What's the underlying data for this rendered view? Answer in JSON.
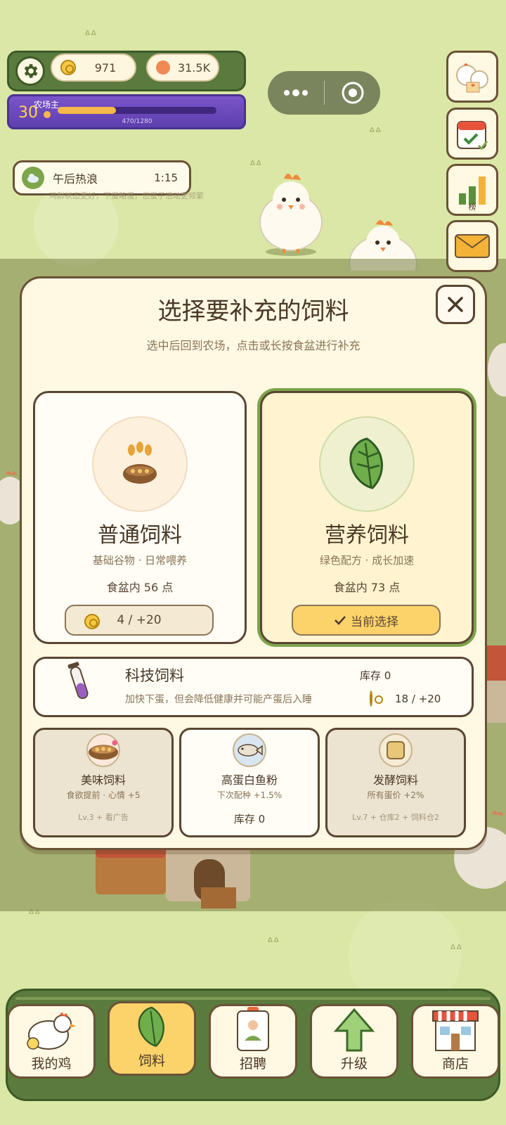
{
  "hud": {
    "coins": "971",
    "eggs": "31.5K",
    "level": "30",
    "level_title": "农场主",
    "xp_text": "470/1280",
    "xp_progress": 0.367
  },
  "weather": {
    "name": "午后热浪",
    "time": "1:15",
    "note": "鸡群状态更好，下蛋略慢，但蛋子活动更频繁"
  },
  "side_buttons": {
    "rank_label": "榜"
  },
  "modal": {
    "title": "选择要补充的饲料",
    "subtitle": "选中后回到农场，点击或长按食盆进行补充",
    "cards": [
      {
        "title": "普通饲料",
        "desc": "基础谷物 · 日常喂养",
        "amount": "食盆内 56 点",
        "button": "4 / +20"
      },
      {
        "title": "营养饲料",
        "desc": "绿色配方 · 成长加速",
        "amount": "食盆内 73 点",
        "button": "当前选择"
      }
    ],
    "tech": {
      "title": "科技饲料",
      "stock": "库存 0",
      "desc": "加快下蛋，但会降低健康并可能产蛋后入睡",
      "price": "18 / +20"
    },
    "small_cards": [
      {
        "title": "美味饲料",
        "desc": "食欲提前 · 心情 +5",
        "foot": "Lv.3 + 看广告"
      },
      {
        "title": "高蛋白鱼粉",
        "desc": "下次配种 +1.5%",
        "foot": "库存 0"
      },
      {
        "title": "发酵饲料",
        "desc": "所有蛋价 +2%",
        "foot": "Lv.7 + 仓库2 + 饲料仓2"
      }
    ]
  },
  "nav": {
    "items": [
      {
        "label": "我的鸡"
      },
      {
        "label": "饲料"
      },
      {
        "label": "招聘"
      },
      {
        "label": "升级"
      },
      {
        "label": "商店"
      }
    ]
  },
  "colors": {
    "accent_green": "#7da54c",
    "gold": "#f6c842",
    "selected_card": "#fff4cf",
    "purple": "#5e3fae"
  }
}
